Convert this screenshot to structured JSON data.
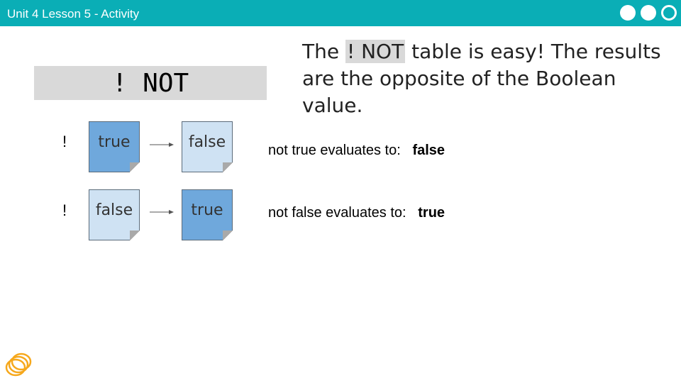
{
  "header": {
    "title": "Unit 4 Lesson 5 - Activity"
  },
  "not_box": {
    "label": "! NOT"
  },
  "intro": {
    "before": "The ",
    "highlight": "! NOT",
    "after": " table is easy! The results are the opposite of the Boolean value."
  },
  "rows": [
    {
      "operator": "!",
      "input": "true",
      "output": "false",
      "statement": "not true evaluates to:",
      "result": "false"
    },
    {
      "operator": "!",
      "input": "false",
      "output": "true",
      "statement": "not false evaluates to:",
      "result": "true"
    }
  ],
  "colors": {
    "topbar": "#0aaeb6",
    "card_dark": "#6fa8dc",
    "card_light": "#cfe2f3",
    "header_box": "#d9d9d9",
    "logo": "#f6a81c"
  }
}
